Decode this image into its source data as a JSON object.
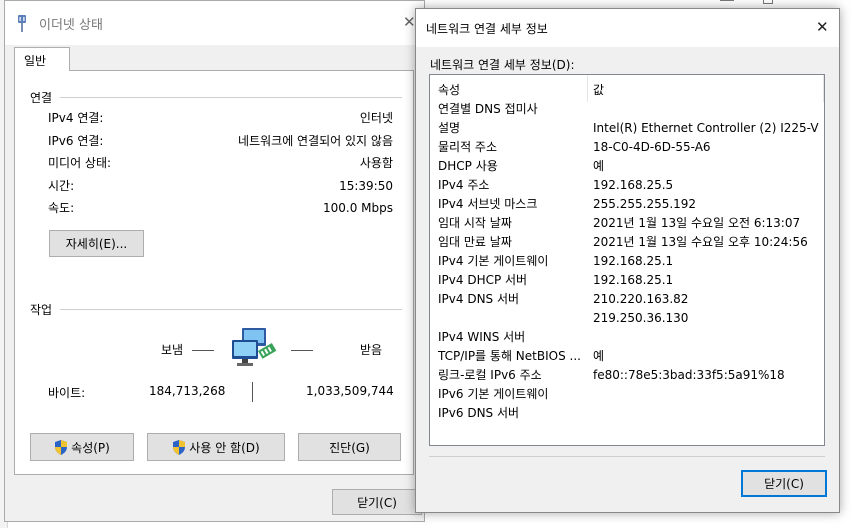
{
  "status_window": {
    "title": "이더넷 상태",
    "tab_general": "일반",
    "connection_group": "연결",
    "rows": [
      {
        "label": "IPv4 연결:",
        "value": "인터넷"
      },
      {
        "label": "IPv6 연결:",
        "value": "네트워크에 연결되어 있지 않음"
      },
      {
        "label": "미디어 상태:",
        "value": "사용함"
      },
      {
        "label": "시간:",
        "value": "15:39:50"
      },
      {
        "label": "속도:",
        "value": "100.0 Mbps"
      }
    ],
    "details_button": "자세히(E)...",
    "activity_group": "작업",
    "sent_label": "보냄",
    "received_label": "받음",
    "bytes_label": "바이트:",
    "bytes_sent": "184,713,268",
    "bytes_received": "1,033,509,744",
    "properties_button": "속성(P)",
    "disable_button": "사용 안 함(D)",
    "diagnose_button": "진단(G)",
    "close_button": "닫기(C)"
  },
  "details_window": {
    "title": "네트워크 연결 세부 정보",
    "list_label": "네트워크 연결 세부 정보(D):",
    "col_property": "속성",
    "col_value": "값",
    "rows": [
      {
        "property": "연결별 DNS 접미사",
        "value": ""
      },
      {
        "property": "설명",
        "value": "Intel(R) Ethernet Controller (2) I225-V"
      },
      {
        "property": "물리적 주소",
        "value": "18-C0-4D-6D-55-A6"
      },
      {
        "property": "DHCP 사용",
        "value": "예"
      },
      {
        "property": "IPv4 주소",
        "value": "192.168.25.5"
      },
      {
        "property": "IPv4 서브넷 마스크",
        "value": "255.255.255.192"
      },
      {
        "property": "임대 시작 날짜",
        "value": "2021년 1월 13일 수요일 오전 6:13:07"
      },
      {
        "property": "임대 만료 날짜",
        "value": "2021년 1월 13일 수요일 오후 10:24:56"
      },
      {
        "property": "IPv4 기본 게이트웨이",
        "value": "192.168.25.1"
      },
      {
        "property": "IPv4 DHCP 서버",
        "value": "192.168.25.1"
      },
      {
        "property": "IPv4 DNS 서버",
        "value": "210.220.163.82"
      },
      {
        "property": "",
        "value": "219.250.36.130"
      },
      {
        "property": "IPv4 WINS 서버",
        "value": ""
      },
      {
        "property": "TCP/IP를 통해 NetBIOS ...",
        "value": "예"
      },
      {
        "property": "링크-로컬 IPv6 주소",
        "value": "fe80::78e5:3bad:33f5:5a91%18"
      },
      {
        "property": "IPv6 기본 게이트웨이",
        "value": ""
      },
      {
        "property": "IPv6 DNS 서버",
        "value": ""
      }
    ],
    "close_button": "닫기(C)"
  },
  "colors": {
    "focus_border": "#0078d7",
    "button_face": "#e1e1e1",
    "window_bg": "#f0f0f0"
  },
  "icons": [
    "ethernet-adapter-icon",
    "network-computers-icon",
    "shield-icon",
    "close-icon"
  ]
}
